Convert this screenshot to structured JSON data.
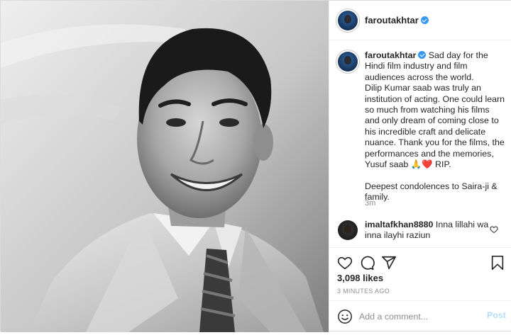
{
  "post": {
    "username": "faroutakhtar",
    "caption_text": "Sad day for the Hindi film industry and film audiences across the world.\nDilip Kumar saab was truly an institution of acting. One could learn so much from watching his films and only dream of coming close to his incredible craft and delicate nuance. Thank you for the films, the performances and the memories, Yusuf saab 🙏❤️ RIP.\n\nDeepest condolences to Saira-ji & family.",
    "caption_age": "3m",
    "likes": "3,098 likes",
    "posted_time": "3 MINUTES AGO"
  },
  "comments": [
    {
      "username": "imaltafkhan8880",
      "text": "Inna lillahi wa inna ilayhi raziun"
    }
  ],
  "add_comment": {
    "placeholder": "Add a comment...",
    "post_label": "Post"
  },
  "colors": {
    "verified": "#3897f0",
    "post_button_disabled": "#b2dffc",
    "muted_text": "#8e8e8e"
  },
  "icons": [
    "heart-icon",
    "comment-icon",
    "share-icon",
    "bookmark-icon",
    "emoji-icon",
    "verified-badge-icon"
  ]
}
